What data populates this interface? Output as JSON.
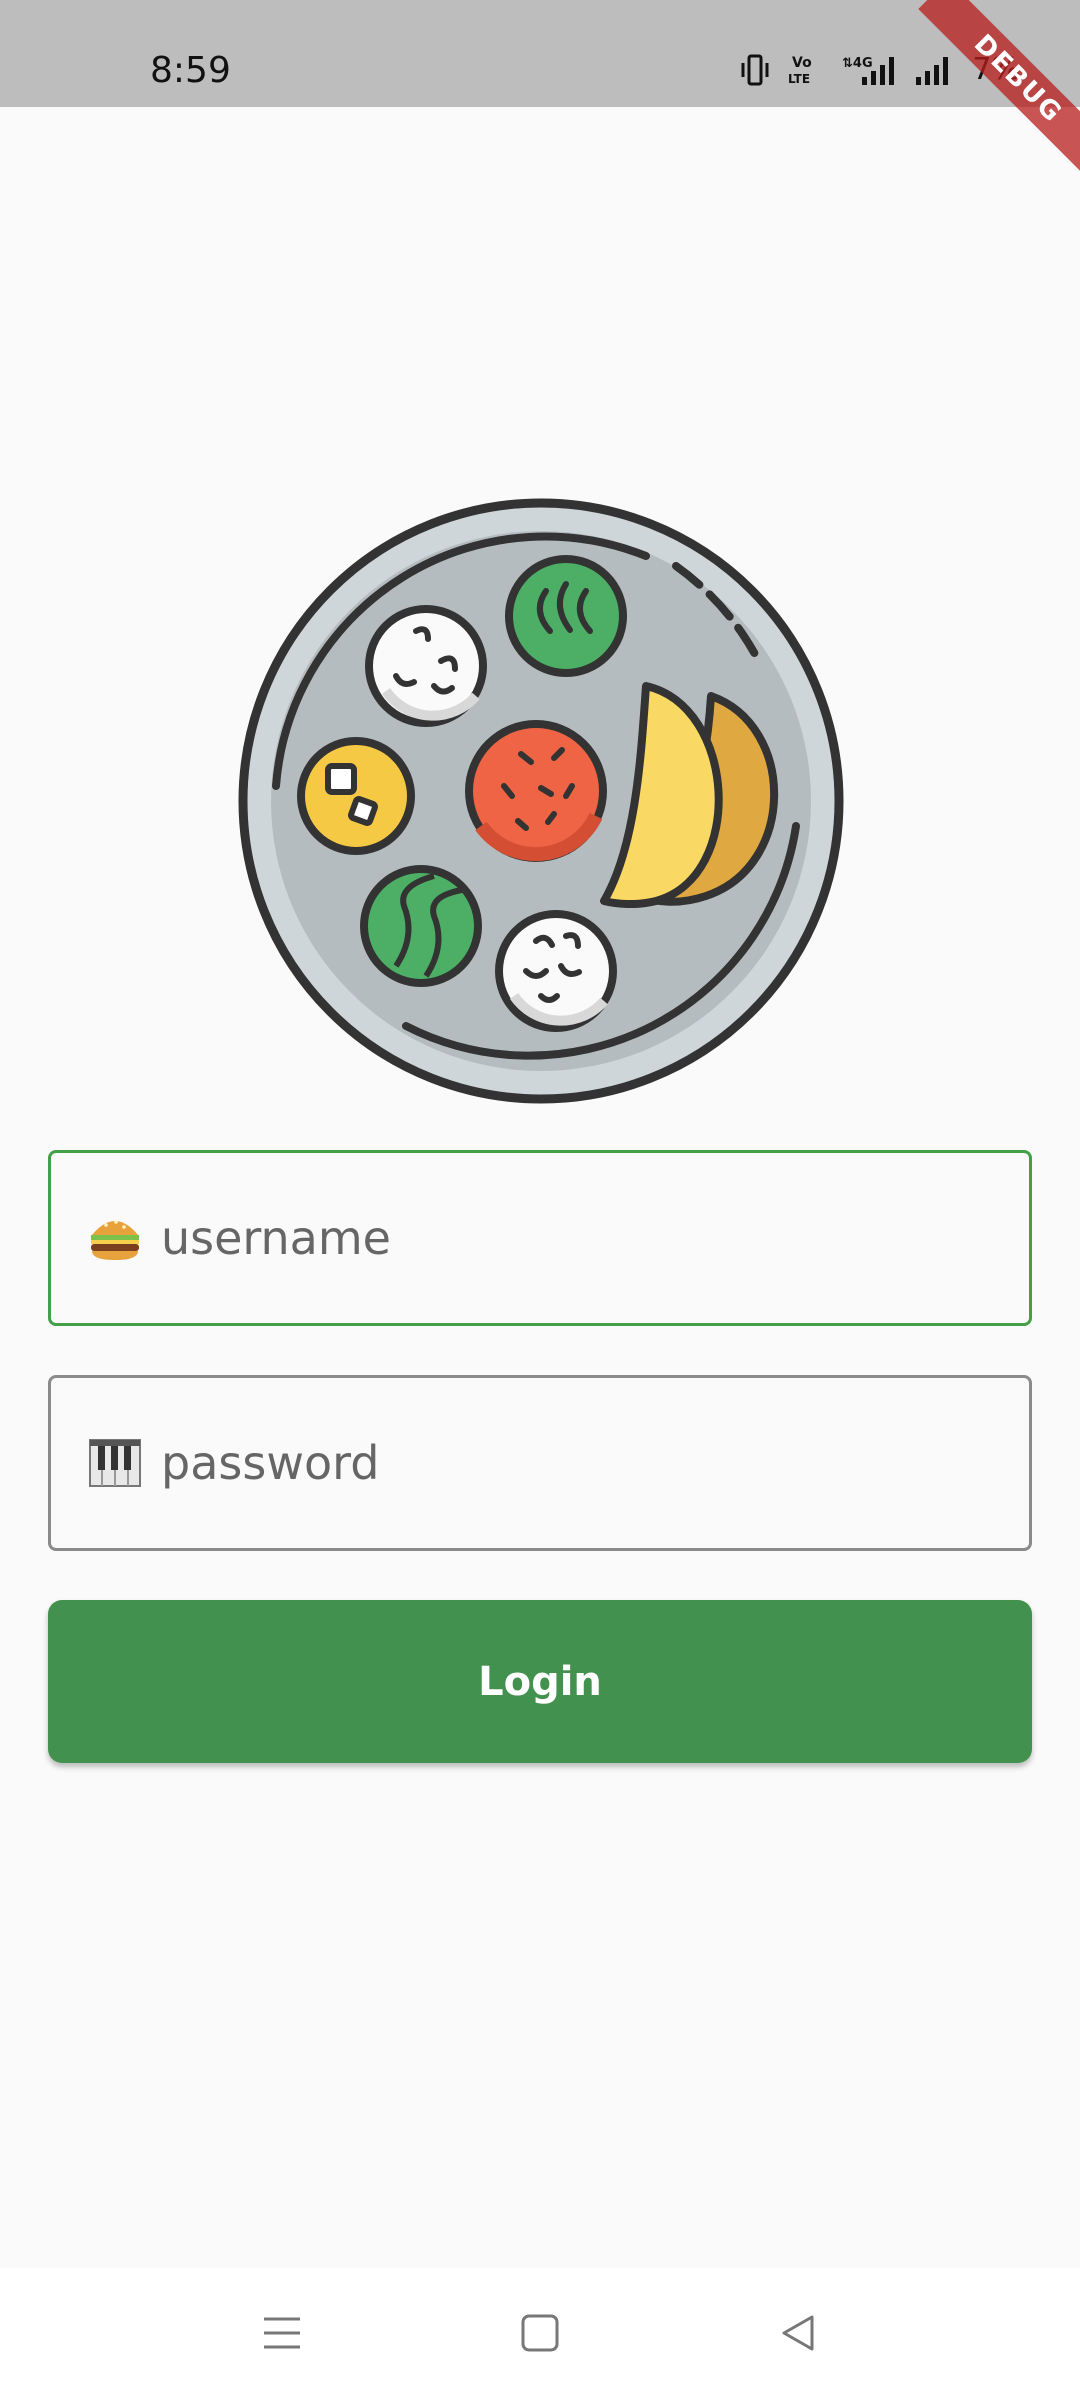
{
  "status_bar": {
    "time": "8:59",
    "battery": "7%",
    "icons": [
      "vibrate-icon",
      "volte-icon",
      "4g-signal-icon",
      "signal-icon",
      "battery-icon"
    ]
  },
  "debug_banner": "DEBUG",
  "login_form": {
    "username": {
      "placeholder": "username",
      "prefix_icon": "burger-icon"
    },
    "password": {
      "placeholder": "password",
      "prefix_icon": "piano-icon"
    },
    "login_label": "Login"
  },
  "colors": {
    "accent": "#43914e",
    "focused_border": "#43a047",
    "status_bar": "#bdbdbd",
    "background": "#fafafa"
  },
  "nav_bar": {
    "icons": [
      "menu-icon",
      "home-icon",
      "back-icon"
    ]
  }
}
